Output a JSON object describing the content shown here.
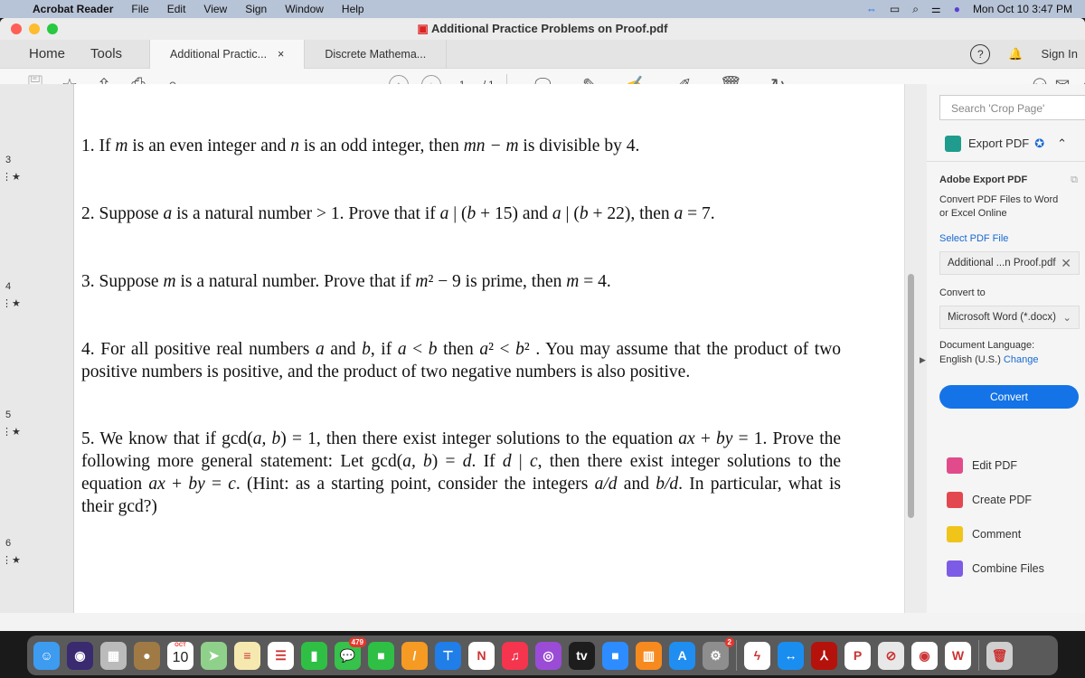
{
  "menubar": {
    "app": "Acrobat Reader",
    "items": [
      "File",
      "Edit",
      "View",
      "Sign",
      "Window",
      "Help"
    ],
    "clock": "Mon Oct 10  3:47 PM"
  },
  "window": {
    "title": "Additional Practice Problems on Proof.pdf"
  },
  "tabs": {
    "home": "Home",
    "tools": "Tools",
    "docs": [
      {
        "label": "Additional Practic...",
        "close": "×",
        "active": true
      },
      {
        "label": "Discrete Mathema...",
        "active": false
      }
    ],
    "help": "?",
    "sign_in": "Sign In"
  },
  "toolbar": {
    "page_current": "1",
    "page_total": "/ 1"
  },
  "thumbnails": {
    "pages": [
      "3",
      "4",
      "5",
      "6"
    ]
  },
  "document": {
    "lines": [
      {
        "seg": [
          [
            "1. If ",
            0
          ],
          [
            "m",
            1
          ],
          [
            " is an even integer and ",
            0
          ],
          [
            "n",
            1
          ],
          [
            " is an odd integer, then ",
            0
          ],
          [
            "mn − m",
            1
          ],
          [
            " is divisible by 4.",
            0
          ]
        ]
      },
      {
        "seg": [
          [
            "2. Suppose ",
            0
          ],
          [
            "a",
            1
          ],
          [
            " is a natural number > 1.  Prove that if ",
            0
          ],
          [
            "a",
            1
          ],
          [
            " | (",
            0
          ],
          [
            "b",
            1
          ],
          [
            " + 15)  and  ",
            0
          ],
          [
            "a",
            1
          ],
          [
            " | (",
            0
          ],
          [
            "b",
            1
          ],
          [
            " + 22), then ",
            0
          ],
          [
            "a",
            1
          ],
          [
            " = 7.",
            0
          ]
        ]
      },
      {
        "seg": [
          [
            "3. Suppose ",
            0
          ],
          [
            "m",
            1
          ],
          [
            " is a natural number.  Prove that if ",
            0
          ],
          [
            "m",
            1
          ],
          [
            "² − 9 is prime, then ",
            0
          ],
          [
            "m",
            1
          ],
          [
            " = 4.",
            0
          ]
        ]
      },
      {
        "seg": [
          [
            "4. For all positive real numbers ",
            0
          ],
          [
            "a",
            1
          ],
          [
            " and ",
            0
          ],
          [
            "b",
            1
          ],
          [
            ", if ",
            0
          ],
          [
            "a",
            1
          ],
          [
            " < ",
            0
          ],
          [
            "b",
            1
          ],
          [
            " then ",
            0
          ],
          [
            "a",
            1
          ],
          [
            "² < ",
            0
          ],
          [
            "b",
            1
          ],
          [
            "² .  You may assume that the product of two",
            0
          ]
        ],
        "justify": true
      },
      {
        "seg": [
          [
            "positive numbers is positive, and the product of two negative numbers is also positive.",
            0
          ]
        ]
      },
      {
        "seg": [
          [
            "5. We know that if gcd(",
            0
          ],
          [
            "a, b",
            1
          ],
          [
            ") = 1, then there exist integer solutions to the equation ",
            0
          ],
          [
            "ax",
            1
          ],
          [
            " + ",
            0
          ],
          [
            "by",
            1
          ],
          [
            " = 1.  Prove the",
            0
          ]
        ],
        "justify": true
      },
      {
        "seg": [
          [
            "following more general statement:  Let gcd(",
            0
          ],
          [
            "a, b",
            1
          ],
          [
            ") = ",
            0
          ],
          [
            "d",
            1
          ],
          [
            ".  If ",
            0
          ],
          [
            "d",
            1
          ],
          [
            " | ",
            0
          ],
          [
            "c",
            1
          ],
          [
            ", then there exist integer solutions to the",
            0
          ]
        ],
        "justify": true
      },
      {
        "seg": [
          [
            "equation ",
            0
          ],
          [
            "ax",
            1
          ],
          [
            " + ",
            0
          ],
          [
            "by",
            1
          ],
          [
            " = ",
            0
          ],
          [
            "c",
            1
          ],
          [
            ".  (Hint:  as a starting point, consider the integers ",
            0
          ],
          [
            "a/d",
            1
          ],
          [
            " and ",
            0
          ],
          [
            "b/d",
            1
          ],
          [
            ".  In particular, what is",
            0
          ]
        ],
        "justify": true
      },
      {
        "seg": [
          [
            "their gcd?)",
            0
          ]
        ]
      }
    ]
  },
  "panel": {
    "search_placeholder": "Search 'Crop Page'",
    "export_label": "Export PDF",
    "section_title": "Adobe Export PDF",
    "description": "Convert PDF Files to Word or Excel Online",
    "select_link": "Select PDF File",
    "selected_file": "Additional ...n Proof.pdf",
    "convert_to_label": "Convert to",
    "convert_to_value": "Microsoft Word (*.docx)",
    "language_label": "Document Language:",
    "language_value": "English (U.S.)",
    "change_link": "Change",
    "convert_button": "Convert",
    "tools": [
      {
        "label": "Edit PDF",
        "color": "#e24b8b"
      },
      {
        "label": "Create PDF",
        "color": "#e34850"
      },
      {
        "label": "Comment",
        "color": "#f0c419"
      },
      {
        "label": "Combine Files",
        "color": "#7c5ce6"
      }
    ]
  },
  "dock": {
    "apps": [
      {
        "name": "finder",
        "color": "#3d9bf0",
        "glyph": "☺"
      },
      {
        "name": "siri",
        "color": "#3a2a70",
        "glyph": "◉"
      },
      {
        "name": "launchpad",
        "color": "#bbbbbb",
        "glyph": "▦"
      },
      {
        "name": "contacts",
        "color": "#a07a45",
        "glyph": "●"
      },
      {
        "name": "calendar",
        "color": "#ffffff",
        "glyph": "10",
        "sub": "OCT"
      },
      {
        "name": "maps",
        "color": "#8fd18a",
        "glyph": "➤"
      },
      {
        "name": "notes",
        "color": "#f5e9b0",
        "glyph": "≡"
      },
      {
        "name": "reminders",
        "color": "#ffffff",
        "glyph": "☰"
      },
      {
        "name": "numbers",
        "color": "#2fbf45",
        "glyph": "▮"
      },
      {
        "name": "messages",
        "color": "#36c24b",
        "glyph": "💬",
        "badge": "479"
      },
      {
        "name": "facetime",
        "color": "#2fbf45",
        "glyph": "■"
      },
      {
        "name": "pages",
        "color": "#f59a23",
        "glyph": "/"
      },
      {
        "name": "keynote",
        "color": "#1f7ee8",
        "glyph": "⊤"
      },
      {
        "name": "news",
        "color": "#ffffff",
        "glyph": "N"
      },
      {
        "name": "music",
        "color": "#f5344e",
        "glyph": "♫"
      },
      {
        "name": "podcasts",
        "color": "#9a4cd6",
        "glyph": "◎"
      },
      {
        "name": "apple-tv",
        "color": "#1d1d1d",
        "glyph": "tv"
      },
      {
        "name": "zoom",
        "color": "#2d8cff",
        "glyph": "■"
      },
      {
        "name": "books",
        "color": "#f78a1f",
        "glyph": "▥"
      },
      {
        "name": "app-store",
        "color": "#1f8ef0",
        "glyph": "A"
      },
      {
        "name": "system-preferences",
        "color": "#8e8e8e",
        "glyph": "⚙",
        "badge": "2"
      },
      {
        "sep": true
      },
      {
        "name": "messenger",
        "color": "#ffffff",
        "glyph": "ϟ"
      },
      {
        "name": "teamviewer",
        "color": "#1a8ef0",
        "glyph": "↔"
      },
      {
        "name": "acrobat",
        "color": "#b5120c",
        "glyph": "⅄"
      },
      {
        "name": "powerpoint",
        "color": "#ffffff",
        "glyph": "P"
      },
      {
        "name": "safari",
        "color": "#e8e8e8",
        "glyph": "⊘"
      },
      {
        "name": "chrome",
        "color": "#ffffff",
        "glyph": "◉"
      },
      {
        "name": "word",
        "color": "#ffffff",
        "glyph": "W"
      },
      {
        "sep": true
      },
      {
        "name": "trash",
        "color": "#cfcfcf",
        "glyph": "🗑"
      }
    ]
  }
}
